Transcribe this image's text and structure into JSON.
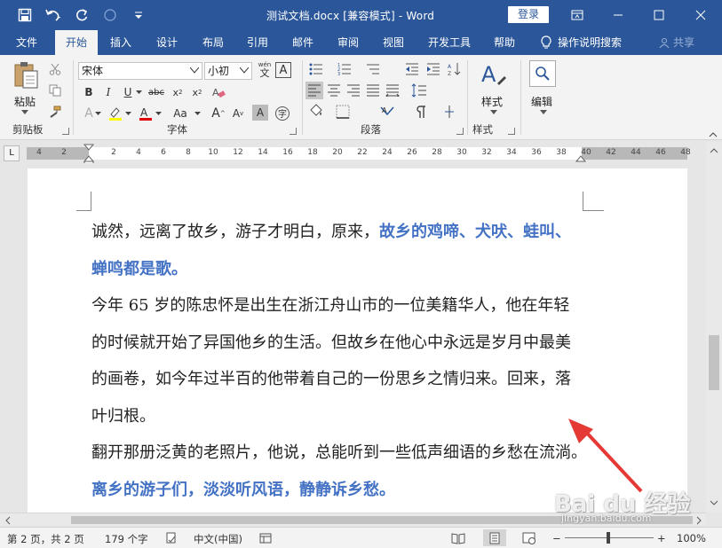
{
  "window": {
    "title": "测试文档.docx [兼容模式]  -  Word",
    "login": "登录"
  },
  "tabs": [
    "文件",
    "开始",
    "插入",
    "设计",
    "布局",
    "引用",
    "邮件",
    "审阅",
    "视图",
    "开发工具",
    "帮助"
  ],
  "tab_tellme": "操作说明搜索",
  "tab_share": "共享",
  "ribbon": {
    "clipboard": {
      "paste": "粘贴",
      "label": "剪贴板"
    },
    "font": {
      "font_name": "宋体",
      "font_size": "小初",
      "label": "字体",
      "pinyin": "wén"
    },
    "paragraph": {
      "label": "段落"
    },
    "styles": {
      "style": "样式",
      "label": "样式"
    },
    "editing": {
      "edit": "编辑"
    }
  },
  "ruler": {
    "left_numbers": [
      "4",
      "2"
    ],
    "numbers": [
      "2",
      "4",
      "6",
      "8",
      "10",
      "12",
      "14",
      "16",
      "18",
      "20",
      "22",
      "24",
      "26",
      "28",
      "30",
      "32",
      "34",
      "36",
      "38"
    ],
    "right_numbers": [
      "40",
      "42",
      "44",
      "46",
      "48"
    ],
    "tab_corner": "L"
  },
  "document": {
    "paragraphs": [
      {
        "segments": [
          {
            "text": "诚然，远离了故乡，游子才明白，原来，",
            "blue": false
          },
          {
            "text": "故乡的鸡啼、犬吠、蛙叫、",
            "blue": true
          }
        ]
      },
      {
        "segments": [
          {
            "text": "蝉鸣都是歌。",
            "blue": true
          }
        ]
      },
      {
        "segments": [
          {
            "text": "今年 65 岁的陈忠怀是出生在浙江舟山市的一位美籍华人，他在年轻",
            "blue": false
          }
        ]
      },
      {
        "segments": [
          {
            "text": "的时候就开始了异国他乡的生活。但故乡在他心中永远是岁月中最美",
            "blue": false
          }
        ]
      },
      {
        "segments": [
          {
            "text": "的画卷，如今年过半百的他带着自己的一份思乡之情归来。回来，落",
            "blue": false
          }
        ]
      },
      {
        "segments": [
          {
            "text": "叶归根。",
            "blue": false
          }
        ]
      },
      {
        "segments": [
          {
            "text": "翻开那册泛黄的老照片，他说，总能听到一些低声细语的乡愁在流淌。",
            "blue": false
          }
        ]
      },
      {
        "segments": [
          {
            "text": "离乡的游子们，淡淡听风语，静静诉乡愁。",
            "blue": true
          }
        ]
      }
    ]
  },
  "status": {
    "page": "第 2 页，共 2 页",
    "words": "179 个字",
    "language": "中文(中国)",
    "zoom": "100%",
    "zoom_minus": "−",
    "zoom_plus": "+"
  },
  "watermark": {
    "text": "Bai du 经验",
    "sub": "jingyan.baidu.com"
  },
  "colors": {
    "title_bar": "#2b579a",
    "ribbon_bg": "#f3f3f3",
    "blue_text": "#4472c4",
    "arrow": "#e53935"
  }
}
